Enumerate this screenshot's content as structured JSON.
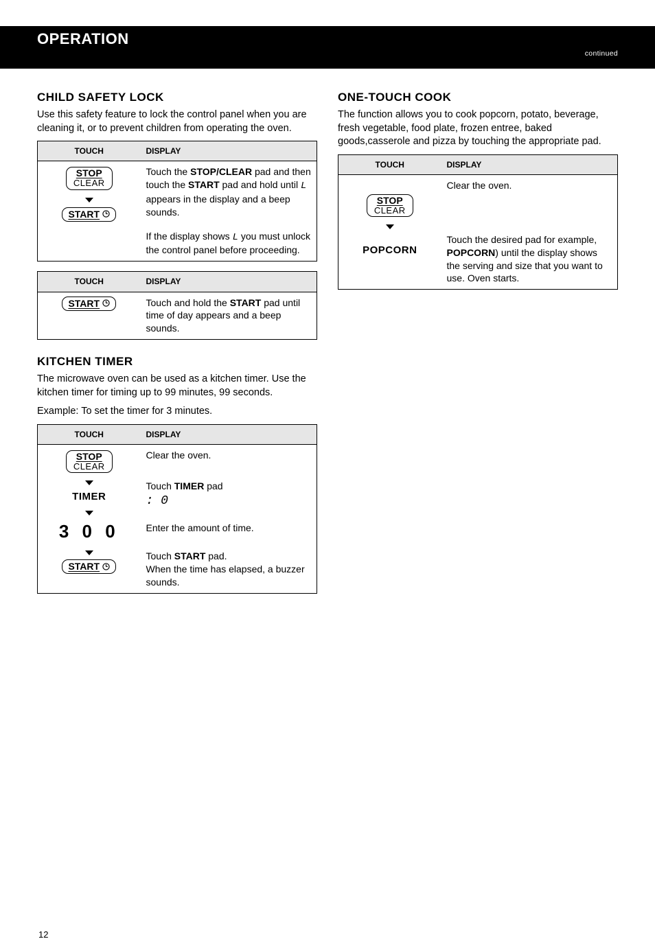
{
  "band": {
    "title": "OPERATION",
    "subtitle": "continued"
  },
  "left": {
    "lock": {
      "title": "CHILD SAFETY LOCK",
      "body1": "Use this safety feature to lock the control panel when you are cleaning it, or to prevent children from operating the oven.",
      "tbl_touch": "TOUCH",
      "tbl_display": "DISPLAY",
      "r1_line1": "Touch the ",
      "r1_bold1": "STOP/CLEAR",
      "r1_line2": " pad and then touch the ",
      "r1_bold2": "START",
      "r1_line3": " pad and hold until ",
      "r1_seg": "L",
      "r1_line4": " appears in the display and a beep sounds.",
      "r2": "If the display shows ",
      "r2_seg": "L",
      "r2_end": " you must unlock the control panel before proceeding.",
      "tbl2_r1": "Touch and hold the ",
      "tbl2_bold": "START",
      "tbl2_r1b": " pad until time of day appears and a beep sounds."
    },
    "timer": {
      "title": "KITCHEN TIMER",
      "body1": "The microwave oven can be used as a kitchen timer. Use the kitchen timer for timing up to 99 minutes, 99 seconds.",
      "example": "Example: To set the timer for 3 minutes.",
      "tbl_touch": "TOUCH",
      "tbl_display": "DISPLAY",
      "row_sc": "Clear the oven.",
      "row_timer_pad": "TIMER",
      "row_timer_txt": "Touch ",
      "row_timer_bold": "TIMER",
      "row_timer_txt2": " pad",
      "row_timer_seg": ": 0",
      "row_digits": "3 0 0",
      "row_digits_txt": "Enter the amount of time.",
      "row_start_txt1": "Touch ",
      "row_start_bold": "START",
      "row_start_txt2": " pad.",
      "row_start_txt3": "When the time has elapsed, a buzzer sounds."
    },
    "page_num": "12"
  },
  "right": {
    "onetouch": {
      "title": "ONE-TOUCH COOK",
      "body1": "The function allows you to cook popcorn, potato, beverage, fresh vegetable, food plate, frozen entree, baked goods,casserole and pizza by touching the appropriate pad.",
      "tbl_touch": "TOUCH",
      "tbl_display": "DISPLAY",
      "row_sc": "Clear the oven.",
      "row_pop_pad": "POPCORN",
      "row_pop_txt1": "Touch the desired pad for example, ",
      "row_pop_bold": "POPCORN",
      "row_pop_txt2": ") until the display shows the serving and size that you want to use. Oven starts."
    }
  }
}
